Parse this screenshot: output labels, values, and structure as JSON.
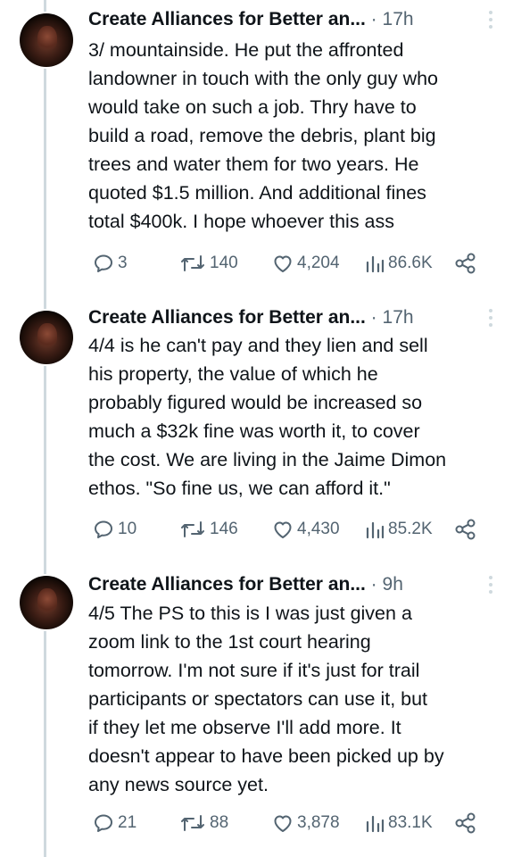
{
  "author": "Create Alliances for Better an...",
  "separator": "·",
  "tweets": [
    {
      "time": "17h",
      "text": "3/  mountainside. He put the affronted\nlandowner in touch with the only guy who\nwould take on such a job. Thry have to\nbuild a road, remove the debris, plant big\ntrees and water them for two years. He\nquoted $1.5 million. And additional fines\ntotal $400k. I hope whoever this ass",
      "replies": "3",
      "retweets": "140",
      "likes": "4,204",
      "views": "86.6K"
    },
    {
      "time": "17h",
      "text": "4/4 is he can't pay and they lien and sell\nhis property, the value of which he\nprobably figured would be increased so\nmuch a $32k fine was worth it, to cover\nthe cost. We are living in the Jaime Dimon\nethos. \"So fine us, we can afford it.\"",
      "replies": "10",
      "retweets": "146",
      "likes": "4,430",
      "views": "85.2K"
    },
    {
      "time": "9h",
      "text": "4/5 The PS to this is I was just given a\nzoom link to the 1st court hearing\ntomorrow. I'm not sure if it's just for trail\nparticipants or spectators can use it, but\nif they let me observe I'll add more. It\ndoesn't appear to have been picked up by\nany news source yet.",
      "replies": "21",
      "retweets": "88",
      "likes": "3,878",
      "views": "83.1K"
    }
  ],
  "colors": {
    "text": "#0f1419",
    "secondary": "#536471",
    "thread_line": "#cfd9de"
  },
  "icons": [
    "reply-icon",
    "retweet-icon",
    "like-icon",
    "views-icon",
    "share-icon",
    "more-icon"
  ]
}
